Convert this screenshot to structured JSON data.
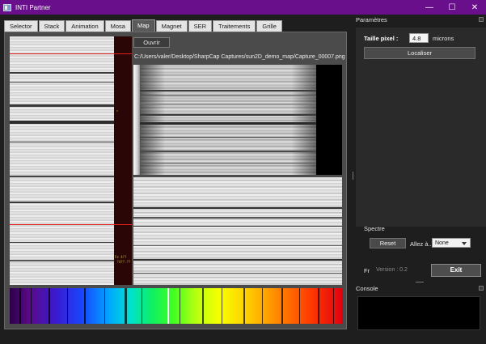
{
  "window": {
    "title": "INTI Partner",
    "minimize": "—",
    "maximize": "☐",
    "close": "✕"
  },
  "tabs": [
    {
      "label": "Selector",
      "active": false
    },
    {
      "label": "Stack",
      "active": false
    },
    {
      "label": "Animation",
      "active": false
    },
    {
      "label": "Mosa",
      "active": false
    },
    {
      "label": "Map",
      "active": true
    },
    {
      "label": "Magnet",
      "active": false
    },
    {
      "label": "SER",
      "active": false
    },
    {
      "label": "Traitements",
      "active": false
    },
    {
      "label": "Grille",
      "active": false
    }
  ],
  "map": {
    "open_label": "Ouvrir",
    "file_path": "C:/Users/valer/Desktop/SharpCap Captures/sun2D_demo_map/Capture_00007.png",
    "overlay_text_1": "Fe 4??",
    "overlay_text_2": " ?4??.??"
  },
  "params": {
    "title": "Paramètres",
    "pixel_size_label": "Taille pixel :",
    "pixel_size_value": "4.8",
    "unit": "microns",
    "locate_label": "Localiser"
  },
  "spectre": {
    "title": "Spectre",
    "reset_label": "Reset",
    "goto_label": "Allez à...",
    "goto_value": "None"
  },
  "footer": {
    "lang": "Fr",
    "version": "Version : 0.2",
    "exit_label": "Exit"
  },
  "console": {
    "title": "Console"
  }
}
